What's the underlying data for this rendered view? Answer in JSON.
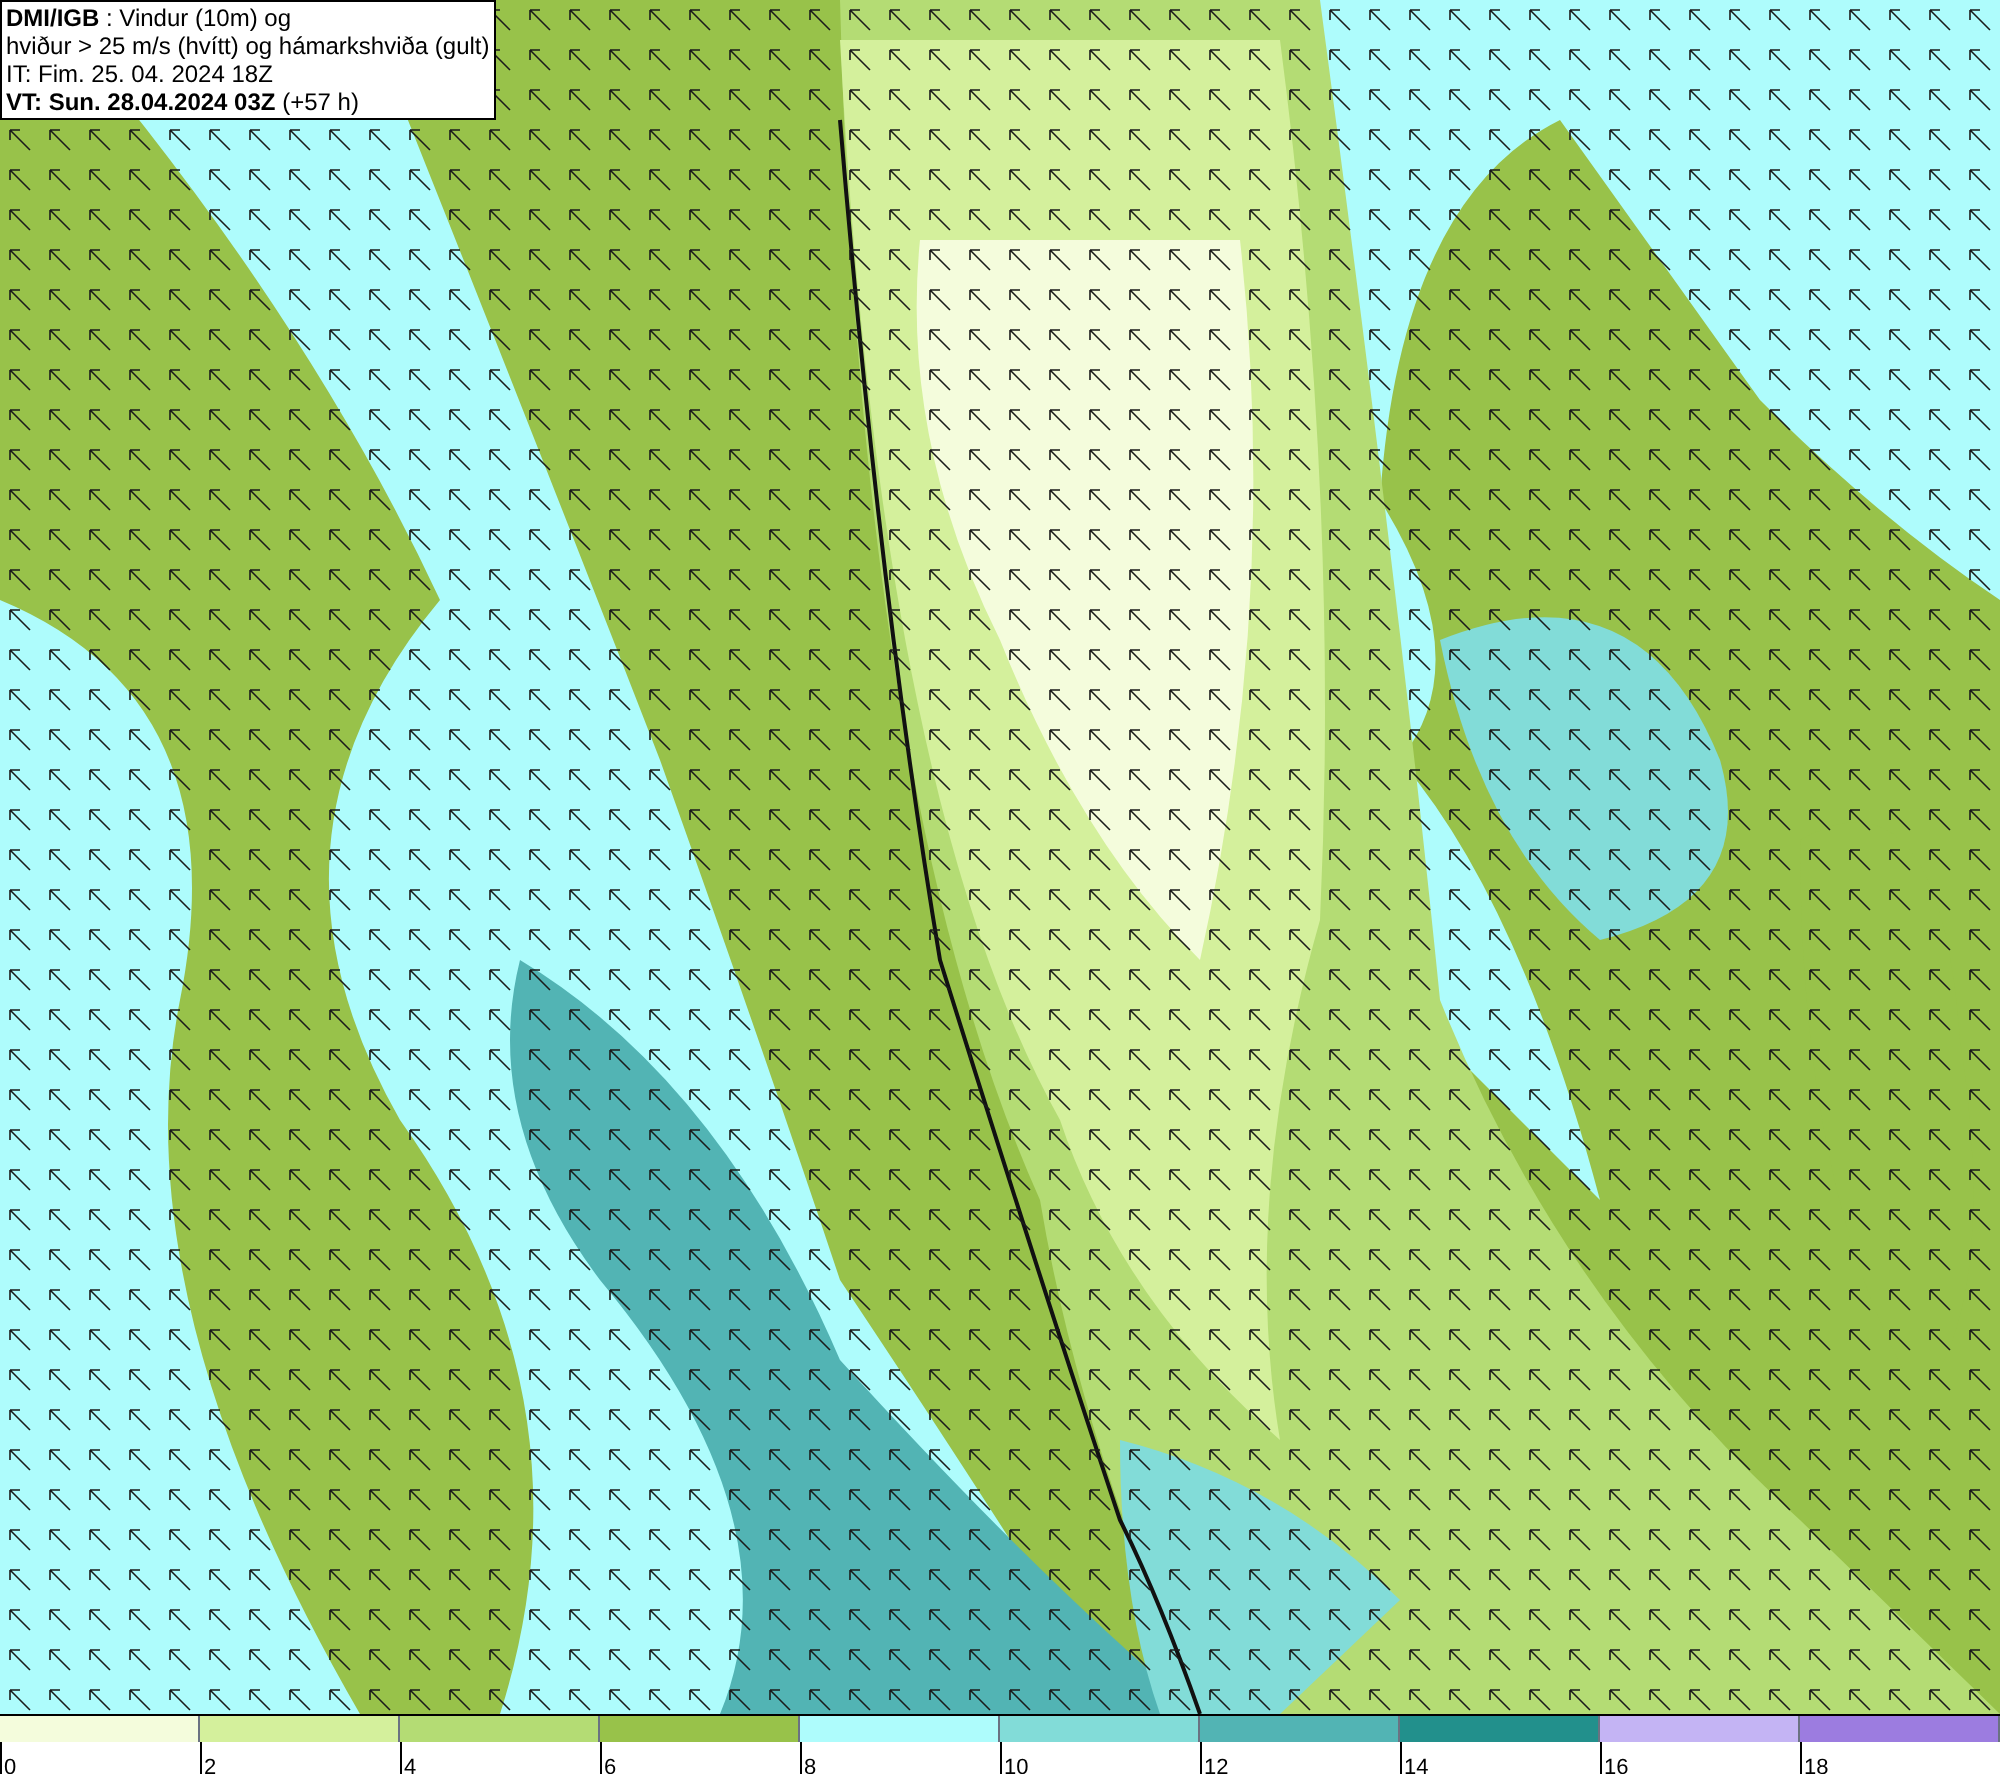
{
  "info_box": {
    "lines": [
      "**DMI/IGB** : Vindur (10m) og",
      "hviður > 25 m/s (hvítt) og hámarkshviða (gult)",
      "IT: Fim. 25. 04. 2024 18Z",
      "**VT: Sun. 28.04.2024 03Z** (+57 h)"
    ]
  },
  "legend": {
    "swatches": [
      {
        "color": "#f4fcdc"
      },
      {
        "color": "#d4f09c"
      },
      {
        "color": "#b4dc74"
      },
      {
        "color": "#98c24a"
      },
      {
        "color": "#aefcfc"
      },
      {
        "color": "#82dcd8"
      },
      {
        "color": "#52b4b4"
      },
      {
        "color": "#22908c"
      },
      {
        "color": "#c4b4f4"
      },
      {
        "color": "#9c7ce0"
      }
    ],
    "labels": [
      "0",
      "2",
      "4",
      "6",
      "8",
      "10",
      "12",
      "14",
      "16",
      "18"
    ]
  }
}
